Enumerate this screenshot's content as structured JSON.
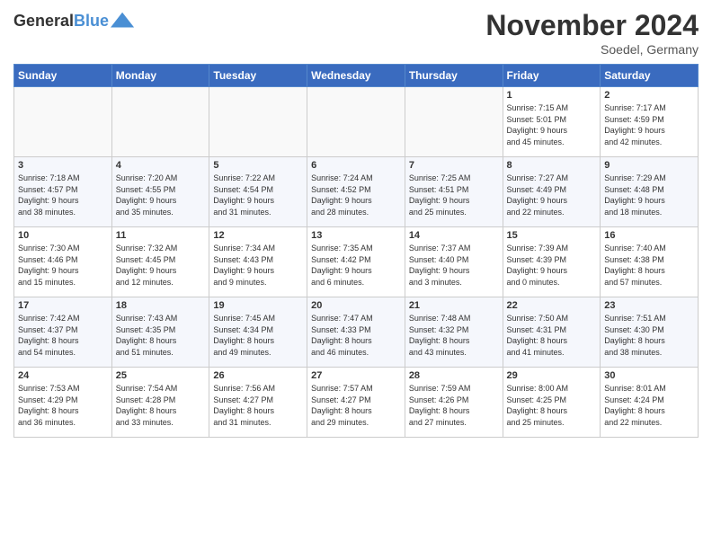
{
  "header": {
    "logo_line1": "General",
    "logo_line2": "Blue",
    "month_title": "November 2024",
    "subtitle": "Soedel, Germany"
  },
  "weekdays": [
    "Sunday",
    "Monday",
    "Tuesday",
    "Wednesday",
    "Thursday",
    "Friday",
    "Saturday"
  ],
  "weeks": [
    [
      {
        "day": "",
        "info": ""
      },
      {
        "day": "",
        "info": ""
      },
      {
        "day": "",
        "info": ""
      },
      {
        "day": "",
        "info": ""
      },
      {
        "day": "",
        "info": ""
      },
      {
        "day": "1",
        "info": "Sunrise: 7:15 AM\nSunset: 5:01 PM\nDaylight: 9 hours\nand 45 minutes."
      },
      {
        "day": "2",
        "info": "Sunrise: 7:17 AM\nSunset: 4:59 PM\nDaylight: 9 hours\nand 42 minutes."
      }
    ],
    [
      {
        "day": "3",
        "info": "Sunrise: 7:18 AM\nSunset: 4:57 PM\nDaylight: 9 hours\nand 38 minutes."
      },
      {
        "day": "4",
        "info": "Sunrise: 7:20 AM\nSunset: 4:55 PM\nDaylight: 9 hours\nand 35 minutes."
      },
      {
        "day": "5",
        "info": "Sunrise: 7:22 AM\nSunset: 4:54 PM\nDaylight: 9 hours\nand 31 minutes."
      },
      {
        "day": "6",
        "info": "Sunrise: 7:24 AM\nSunset: 4:52 PM\nDaylight: 9 hours\nand 28 minutes."
      },
      {
        "day": "7",
        "info": "Sunrise: 7:25 AM\nSunset: 4:51 PM\nDaylight: 9 hours\nand 25 minutes."
      },
      {
        "day": "8",
        "info": "Sunrise: 7:27 AM\nSunset: 4:49 PM\nDaylight: 9 hours\nand 22 minutes."
      },
      {
        "day": "9",
        "info": "Sunrise: 7:29 AM\nSunset: 4:48 PM\nDaylight: 9 hours\nand 18 minutes."
      }
    ],
    [
      {
        "day": "10",
        "info": "Sunrise: 7:30 AM\nSunset: 4:46 PM\nDaylight: 9 hours\nand 15 minutes."
      },
      {
        "day": "11",
        "info": "Sunrise: 7:32 AM\nSunset: 4:45 PM\nDaylight: 9 hours\nand 12 minutes."
      },
      {
        "day": "12",
        "info": "Sunrise: 7:34 AM\nSunset: 4:43 PM\nDaylight: 9 hours\nand 9 minutes."
      },
      {
        "day": "13",
        "info": "Sunrise: 7:35 AM\nSunset: 4:42 PM\nDaylight: 9 hours\nand 6 minutes."
      },
      {
        "day": "14",
        "info": "Sunrise: 7:37 AM\nSunset: 4:40 PM\nDaylight: 9 hours\nand 3 minutes."
      },
      {
        "day": "15",
        "info": "Sunrise: 7:39 AM\nSunset: 4:39 PM\nDaylight: 9 hours\nand 0 minutes."
      },
      {
        "day": "16",
        "info": "Sunrise: 7:40 AM\nSunset: 4:38 PM\nDaylight: 8 hours\nand 57 minutes."
      }
    ],
    [
      {
        "day": "17",
        "info": "Sunrise: 7:42 AM\nSunset: 4:37 PM\nDaylight: 8 hours\nand 54 minutes."
      },
      {
        "day": "18",
        "info": "Sunrise: 7:43 AM\nSunset: 4:35 PM\nDaylight: 8 hours\nand 51 minutes."
      },
      {
        "day": "19",
        "info": "Sunrise: 7:45 AM\nSunset: 4:34 PM\nDaylight: 8 hours\nand 49 minutes."
      },
      {
        "day": "20",
        "info": "Sunrise: 7:47 AM\nSunset: 4:33 PM\nDaylight: 8 hours\nand 46 minutes."
      },
      {
        "day": "21",
        "info": "Sunrise: 7:48 AM\nSunset: 4:32 PM\nDaylight: 8 hours\nand 43 minutes."
      },
      {
        "day": "22",
        "info": "Sunrise: 7:50 AM\nSunset: 4:31 PM\nDaylight: 8 hours\nand 41 minutes."
      },
      {
        "day": "23",
        "info": "Sunrise: 7:51 AM\nSunset: 4:30 PM\nDaylight: 8 hours\nand 38 minutes."
      }
    ],
    [
      {
        "day": "24",
        "info": "Sunrise: 7:53 AM\nSunset: 4:29 PM\nDaylight: 8 hours\nand 36 minutes."
      },
      {
        "day": "25",
        "info": "Sunrise: 7:54 AM\nSunset: 4:28 PM\nDaylight: 8 hours\nand 33 minutes."
      },
      {
        "day": "26",
        "info": "Sunrise: 7:56 AM\nSunset: 4:27 PM\nDaylight: 8 hours\nand 31 minutes."
      },
      {
        "day": "27",
        "info": "Sunrise: 7:57 AM\nSunset: 4:27 PM\nDaylight: 8 hours\nand 29 minutes."
      },
      {
        "day": "28",
        "info": "Sunrise: 7:59 AM\nSunset: 4:26 PM\nDaylight: 8 hours\nand 27 minutes."
      },
      {
        "day": "29",
        "info": "Sunrise: 8:00 AM\nSunset: 4:25 PM\nDaylight: 8 hours\nand 25 minutes."
      },
      {
        "day": "30",
        "info": "Sunrise: 8:01 AM\nSunset: 4:24 PM\nDaylight: 8 hours\nand 22 minutes."
      }
    ]
  ]
}
